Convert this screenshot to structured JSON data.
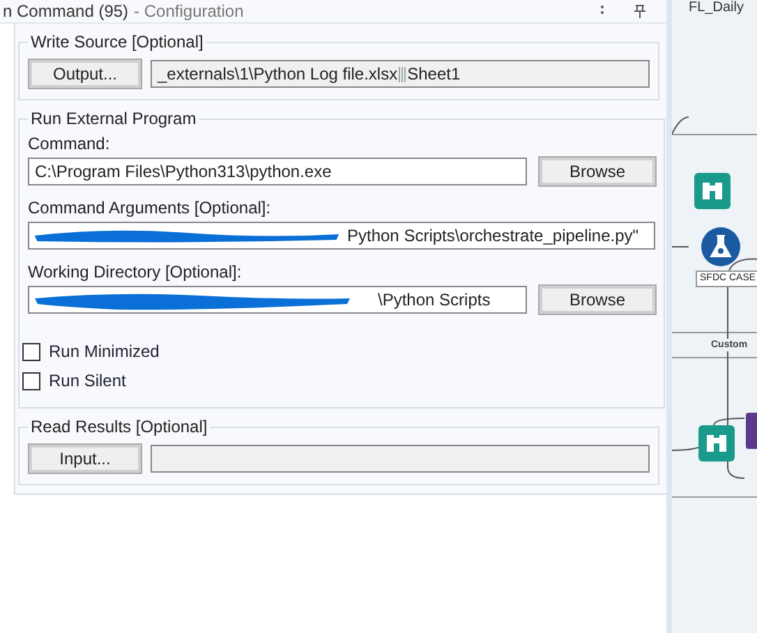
{
  "window": {
    "title": "n Command (95)",
    "subtitle": "- Configuration"
  },
  "canvas": {
    "workflow_tab": "FL_Daily",
    "tool_label": "SFDC CASE",
    "container_label": "Custom"
  },
  "write_source": {
    "legend": "Write Source [Optional]",
    "button": "Output...",
    "file": "_externals\\1\\Python Log file.xlsx",
    "sheet": "Sheet1"
  },
  "run_external": {
    "legend": "Run External Program",
    "command_label": "Command:",
    "command_value": "C:\\Program Files\\Python313\\python.exe",
    "command_browse": "Browse",
    "args_label": "Command Arguments [Optional]:",
    "args_value": "Python Scripts\\orchestrate_pipeline.py\"",
    "workdir_label": "Working Directory [Optional]:",
    "workdir_value": "\\Python Scripts",
    "workdir_browse": "Browse"
  },
  "checkboxes": [
    {
      "label": "Run Minimized",
      "checked": false
    },
    {
      "label": "Run Silent",
      "checked": false
    }
  ],
  "read_results": {
    "legend": "Read Results [Optional]",
    "button": "Input..."
  }
}
